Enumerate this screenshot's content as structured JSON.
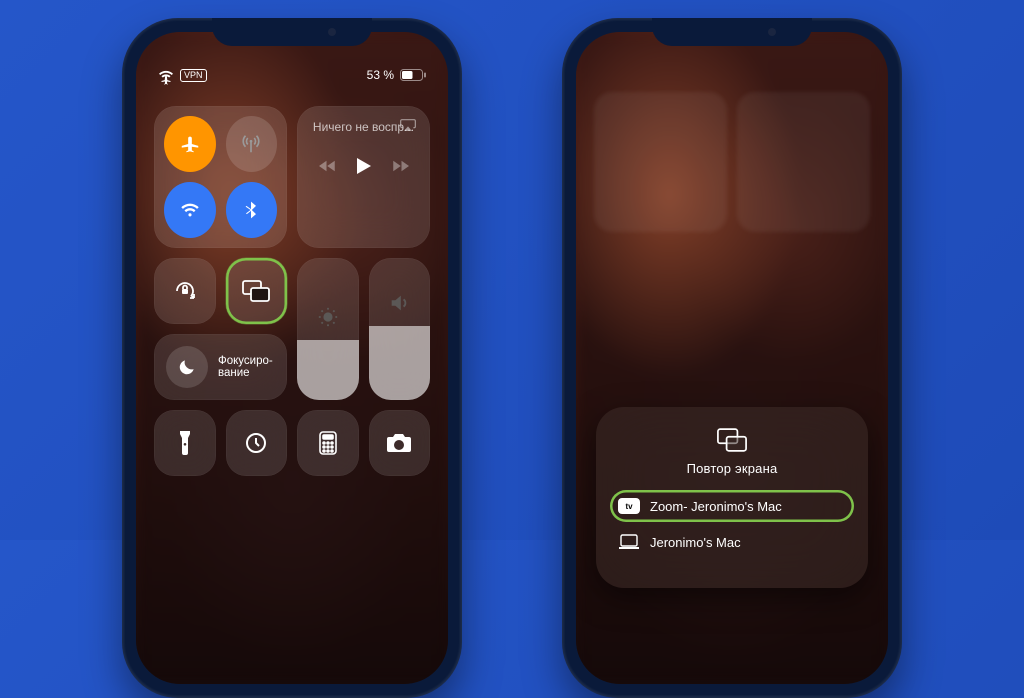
{
  "status": {
    "vpn_label": "VPN",
    "battery_text": "53 %"
  },
  "control_center": {
    "media": {
      "now_playing": "Ничего не воспр..."
    },
    "focus": {
      "label": "Фокусиро-\nвание"
    },
    "icons": {
      "airplane": "airplane-icon",
      "cellular": "cellular-antenna-icon",
      "wifi": "wifi-icon",
      "bluetooth": "bluetooth-icon",
      "lock_rotation": "rotation-lock-icon",
      "screen_mirroring": "screen-mirroring-icon",
      "do_not_disturb": "moon-icon",
      "brightness": "sun-icon",
      "volume": "speaker-icon",
      "flashlight": "flashlight-icon",
      "timer": "timer-icon",
      "calculator": "calculator-icon",
      "camera": "camera-icon"
    }
  },
  "mirroring_sheet": {
    "title": "Повтор экрана",
    "devices": [
      {
        "icon": "appletv-icon",
        "label": "Zoom- Jeronimo's Mac",
        "highlighted": true
      },
      {
        "icon": "laptop-icon",
        "label": " Jeronimo's Mac",
        "highlighted": false
      }
    ]
  },
  "colors": {
    "highlight_green": "#7fc24a",
    "toggle_orange": "#ff9500",
    "toggle_blue": "#3478f6"
  }
}
